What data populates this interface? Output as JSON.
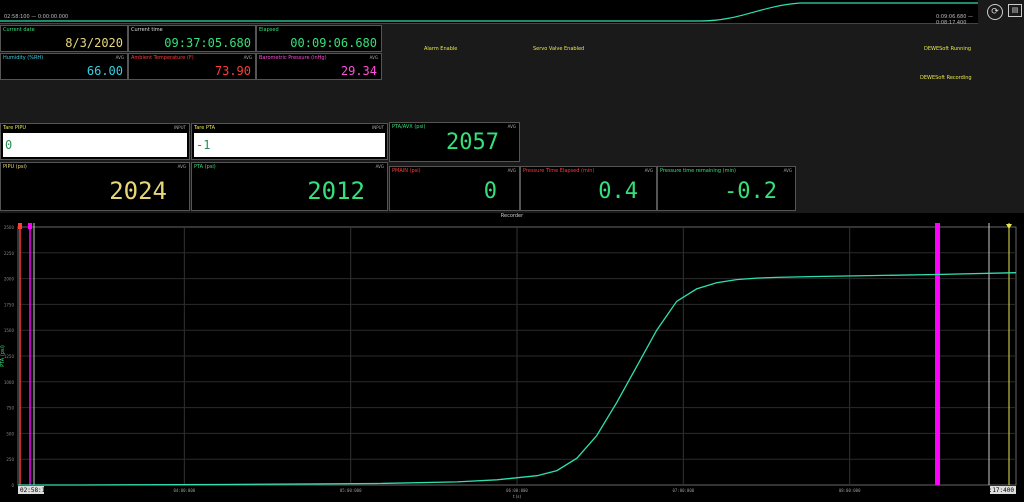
{
  "overview": {
    "start_label": "02:58:100 — 0:00:00.000",
    "end_label": "0:09:06.680 — 0:08:17.400"
  },
  "toolbar": {
    "reset_icon": "refresh-icon",
    "panel_icon": "panel-icon"
  },
  "header_cells": {
    "current_date": {
      "label": "Current date",
      "value": "8/3/2020"
    },
    "current_time": {
      "label": "Current time",
      "value": "09:37:05.680"
    },
    "elapsed": {
      "label": "Elapsed",
      "value": "00:09:06.680"
    },
    "humidity": {
      "label": "Humidity (%RH)",
      "tag": "AVG",
      "value": "66.00"
    },
    "ambient_temp": {
      "label": "Ambient Temperature (F)",
      "tag": "AVG",
      "value": "73.90"
    },
    "barometric": {
      "label": "Barometric Pressure (inHg)",
      "tag": "AVG",
      "value": "29.34"
    }
  },
  "status": {
    "alarm": "Alarm Enable",
    "servo": "Servo Valve Enabled",
    "running": "DEWESoft Running",
    "recording": "DEWESoft Recording"
  },
  "inputs": {
    "tare_pipu": {
      "label": "Tare PIPU",
      "tag": "INPUT",
      "value": "0"
    },
    "tare_pta": {
      "label": "Tare PTA",
      "tag": "INPUT",
      "value": "-1"
    }
  },
  "meters": {
    "ptavax": {
      "label": "PTA/AVX (psi)",
      "tag": "AVG",
      "value": "2057",
      "color": "#35e07a"
    },
    "pipu": {
      "label": "PIPU (psi)",
      "tag": "AVG",
      "value": "2024",
      "color": "#e8d77a"
    },
    "pta": {
      "label": "PTA (psi)",
      "tag": "AVG",
      "value": "2012",
      "color": "#35e07a"
    },
    "pmain": {
      "label": "PMAIN (psi)",
      "tag": "AVG",
      "value": "0",
      "color": "#35e07a"
    },
    "pressure_time_elapsed": {
      "label": "Pressure Time Elapsed (min)",
      "tag": "AVG",
      "value": "0.4",
      "color": "#35e07a"
    },
    "pressure_time_remaining": {
      "label": "Pressure time remaining (min)",
      "tag": "AVG",
      "value": "-0.2",
      "color": "#35e07a"
    }
  },
  "recorder": {
    "title": "Recorder",
    "ylabel": "PTA (psi)",
    "xlabel": "t (s)",
    "start_time": "02:58:100",
    "end_time": "08:17:400"
  },
  "colors": {
    "label_green": "#35e07a",
    "label_red": "#ff3b3b",
    "label_pink": "#ff4fd8",
    "label_cyan": "#35d0e0",
    "trace": "#2fe0b0",
    "cursor_magenta": "#ff00ff"
  },
  "chart_data": {
    "type": "line",
    "title": "Recorder",
    "xlabel": "t (s)",
    "ylabel": "PTA (psi)",
    "x_tick_labels": [
      "02:58:100",
      "04:00:000",
      "05:00:000",
      "06:00:000",
      "07:00:000",
      "08:00:000",
      "08:17:400"
    ],
    "y_tick_labels": [
      "2500",
      "2250",
      "2000",
      "1750",
      "1500",
      "1250",
      "1000",
      "750",
      "500",
      "250",
      "0"
    ],
    "ylim": [
      0,
      2500
    ],
    "grid": true,
    "series": [
      {
        "name": "PTA (psi)",
        "x": [
          0,
          30,
          60,
          100,
          140,
          180,
          220,
          240,
          260,
          270,
          280,
          290,
          300,
          310,
          320,
          330,
          340,
          350,
          360,
          370,
          380,
          400,
          430,
          460,
          500
        ],
        "y": [
          0,
          0,
          2,
          5,
          10,
          15,
          30,
          50,
          90,
          140,
          260,
          480,
          800,
          1150,
          1500,
          1780,
          1900,
          1960,
          1990,
          2005,
          2012,
          2020,
          2030,
          2040,
          2057
        ]
      }
    ]
  }
}
